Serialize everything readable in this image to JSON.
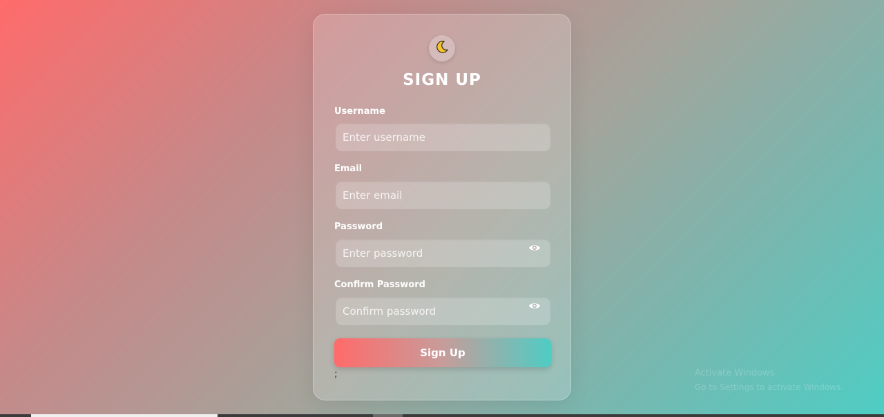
{
  "theme_toggle": {
    "icon": "moon-icon",
    "glyph": "🌙"
  },
  "form": {
    "title": "SIGN UP",
    "username": {
      "label": "Username",
      "placeholder": "Enter username",
      "value": ""
    },
    "email": {
      "label": "Email",
      "placeholder": "Enter email",
      "value": ""
    },
    "password": {
      "label": "Password",
      "placeholder": "Enter password",
      "value": "",
      "toggle_icon": "eye-icon"
    },
    "confirm_password": {
      "label": "Confirm Password",
      "placeholder": "Confirm password",
      "value": "",
      "toggle_icon": "eye-icon"
    },
    "submit_label": "Sign Up",
    "stray_text": ";"
  },
  "watermark": {
    "line1": "Activate Windows",
    "line2": "Go to Settings to activate Windows."
  },
  "colors": {
    "gradient_start": "#ff6b6b",
    "gradient_end": "#4ecdc4",
    "text": "#ffffff"
  }
}
